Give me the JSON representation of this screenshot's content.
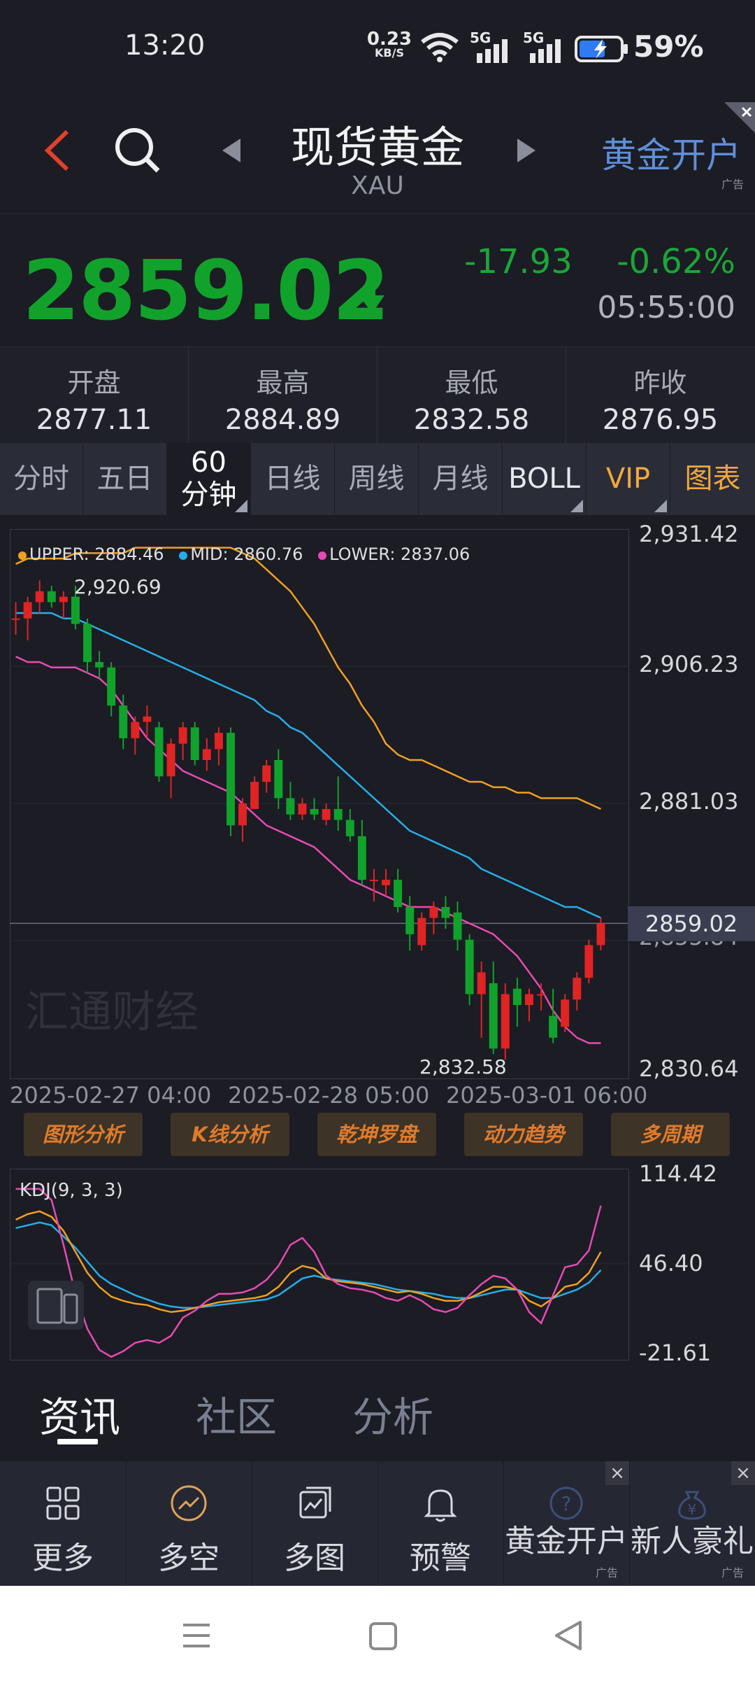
{
  "status": {
    "time": "13:20",
    "net_speed": "0.23",
    "net_unit": "KB/S",
    "sim1": "5G",
    "sim2": "5G",
    "battery": "59%"
  },
  "header": {
    "title": "现货黄金",
    "subtitle": "XAU",
    "promo": "黄金开户",
    "ad_label": "广告",
    "close": "×"
  },
  "price": {
    "last": "2859.02",
    "change": "-17.93",
    "change_pct": "-0.62%",
    "time": "05:55:00",
    "color": "#11a22c"
  },
  "stats": [
    {
      "label": "开盘",
      "value": "2877.11"
    },
    {
      "label": "最高",
      "value": "2884.89"
    },
    {
      "label": "最低",
      "value": "2832.58"
    },
    {
      "label": "昨收",
      "value": "2876.95"
    }
  ],
  "tabs": [
    "分时",
    "五日",
    "60分钟",
    "日线",
    "周线",
    "月线",
    "BOLL",
    "VIP",
    "图表"
  ],
  "legend": {
    "upper": "UPPER: 2884.46",
    "mid": "MID: 2860.76",
    "lower": "LOWER: 2837.06"
  },
  "chart_labels": {
    "y_ticks": [
      "2,931.42",
      "2,906.23",
      "2,881.03",
      "2,855.84",
      "2,830.64"
    ],
    "current_price_tag": "2859.02",
    "high_marker": "2,920.69",
    "low_marker": "2,832.58",
    "x_ticks": [
      "2025-02-27 04:00",
      "2025-02-28 05:00",
      "2025-03-01 06:00"
    ],
    "watermark": "汇通财经"
  },
  "tools": [
    "图形分析",
    "K线分析",
    "乾坤罗盘",
    "动力趋势",
    "多周期"
  ],
  "kdj": {
    "label": "KDJ(9, 3, 3)",
    "y_ticks": [
      "114.42",
      "46.40",
      "-21.61"
    ]
  },
  "news_tabs": [
    "资讯",
    "社区",
    "分析"
  ],
  "bottom_bar": [
    {
      "label": "更多",
      "icon": "grid-icon"
    },
    {
      "label": "多空",
      "icon": "trend-icon"
    },
    {
      "label": "多图",
      "icon": "multi-chart-icon"
    },
    {
      "label": "预警",
      "icon": "bell-icon"
    },
    {
      "label": "黄金开户",
      "icon": "help-icon",
      "ad": "广告"
    },
    {
      "label": "新人豪礼",
      "icon": "money-bag-icon",
      "ad": "广告"
    }
  ],
  "colors": {
    "up": "#e02424",
    "down": "#11a22c",
    "upper": "#f0a020",
    "mid": "#26aee8",
    "lower": "#e84ab4",
    "promo": "#5f8fd8",
    "vip": "#f2a83a"
  },
  "chart_data": {
    "type": "candlestick",
    "ylim": [
      2830.64,
      2931.42
    ],
    "candles": [
      [
        2915,
        2918,
        2912,
        2915
      ],
      [
        2915,
        2919,
        2911,
        2918
      ],
      [
        2918,
        2922,
        2916,
        2920
      ],
      [
        2920,
        2921,
        2917,
        2918
      ],
      [
        2918,
        2920,
        2915,
        2919
      ],
      [
        2919,
        2921,
        2913,
        2914
      ],
      [
        2914,
        2915,
        2905,
        2907
      ],
      [
        2907,
        2909,
        2904,
        2906
      ],
      [
        2906,
        2907,
        2897,
        2899
      ],
      [
        2899,
        2901,
        2891,
        2893
      ],
      [
        2893,
        2897,
        2890,
        2896
      ],
      [
        2896,
        2899,
        2893,
        2897
      ],
      [
        2895,
        2896,
        2885,
        2886
      ],
      [
        2886,
        2893,
        2882,
        2892
      ],
      [
        2892,
        2896,
        2889,
        2895
      ],
      [
        2895,
        2896,
        2888,
        2889
      ],
      [
        2889,
        2893,
        2887,
        2891
      ],
      [
        2891,
        2895,
        2888,
        2894
      ],
      [
        2894,
        2895,
        2875,
        2877
      ],
      [
        2877,
        2882,
        2874,
        2881
      ],
      [
        2880,
        2886,
        2880,
        2885
      ],
      [
        2885,
        2889,
        2883,
        2888
      ],
      [
        2889,
        2891,
        2880,
        2882
      ],
      [
        2882,
        2885,
        2878,
        2879
      ],
      [
        2879,
        2882,
        2878,
        2881
      ],
      [
        2880,
        2882,
        2878,
        2879
      ],
      [
        2878,
        2881,
        2877,
        2880
      ],
      [
        2880,
        2886,
        2876,
        2878
      ],
      [
        2878,
        2880,
        2874,
        2875
      ],
      [
        2875,
        2878,
        2866,
        2867
      ],
      [
        2867,
        2869,
        2863,
        2867
      ],
      [
        2866,
        2869,
        2864,
        2867
      ],
      [
        2867,
        2869,
        2861,
        2862
      ],
      [
        2862,
        2864,
        2854,
        2857
      ],
      [
        2855,
        2861,
        2854,
        2860
      ],
      [
        2860,
        2863,
        2857,
        2862
      ],
      [
        2862,
        2864,
        2858,
        2860
      ],
      [
        2861,
        2863,
        2854,
        2856
      ],
      [
        2856,
        2857,
        2844,
        2846
      ],
      [
        2846,
        2852,
        2838,
        2850
      ],
      [
        2848,
        2852,
        2835,
        2836
      ],
      [
        2836,
        2848,
        2834,
        2846
      ],
      [
        2847,
        2849,
        2840,
        2844
      ],
      [
        2844,
        2847,
        2841,
        2846
      ],
      [
        2846,
        2848,
        2843,
        2846
      ],
      [
        2842,
        2847,
        2837,
        2838
      ],
      [
        2840,
        2846,
        2839,
        2845
      ],
      [
        2845,
        2850,
        2843,
        2849
      ],
      [
        2849,
        2856,
        2848,
        2855
      ],
      [
        2855,
        2860,
        2854,
        2859
      ]
    ],
    "boll_upper": [
      2925,
      2926,
      2926,
      2926,
      2926,
      2927,
      2927,
      2927,
      2927,
      2927,
      2928,
      2928,
      2928,
      2928,
      2928,
      2928,
      2928,
      2928,
      2928,
      2927,
      2926,
      2924,
      2922,
      2920,
      2917,
      2914,
      2910,
      2906,
      2903,
      2899,
      2896,
      2892,
      2890,
      2889,
      2889,
      2888,
      2887,
      2886,
      2885,
      2885,
      2884,
      2884,
      2883,
      2883,
      2882,
      2882,
      2882,
      2882,
      2881,
      2880
    ],
    "boll_mid": [
      2916,
      2916,
      2916,
      2916,
      2915,
      2915,
      2914,
      2913,
      2912,
      2911,
      2910,
      2909,
      2908,
      2907,
      2906,
      2905,
      2904,
      2903,
      2902,
      2901,
      2900,
      2898,
      2897,
      2895,
      2894,
      2892,
      2890,
      2888,
      2886,
      2884,
      2882,
      2880,
      2878,
      2876,
      2875,
      2874,
      2873,
      2872,
      2871,
      2869,
      2868,
      2867,
      2866,
      2865,
      2864,
      2863,
      2862,
      2862,
      2861,
      2860
    ],
    "boll_lower": [
      2908,
      2907,
      2907,
      2906,
      2906,
      2906,
      2905,
      2904,
      2902,
      2899,
      2896,
      2893,
      2891,
      2889,
      2887,
      2886,
      2885,
      2884,
      2883,
      2881,
      2879,
      2877,
      2876,
      2875,
      2874,
      2873,
      2871,
      2869,
      2867,
      2866,
      2865,
      2864,
      2863,
      2862,
      2862,
      2862,
      2861,
      2860,
      2859,
      2858,
      2857,
      2855,
      2853,
      2850,
      2847,
      2843,
      2840,
      2838,
      2837,
      2837
    ],
    "kdj": {
      "ylim": [
        -21.61,
        114.42
      ],
      "k": [
        78,
        82,
        84,
        80,
        70,
        55,
        40,
        30,
        23,
        20,
        18,
        17,
        14,
        12,
        13,
        15,
        17,
        19,
        20,
        21,
        22,
        24,
        30,
        40,
        45,
        43,
        36,
        34,
        33,
        32,
        30,
        28,
        26,
        27,
        25,
        22,
        20,
        20,
        22,
        26,
        30,
        30,
        28,
        20,
        16,
        22,
        30,
        32,
        40,
        55
      ],
      "d": [
        72,
        74,
        76,
        74,
        66,
        58,
        48,
        38,
        32,
        28,
        24,
        21,
        18,
        16,
        15,
        15,
        16,
        17,
        18,
        19,
        20,
        21,
        24,
        30,
        36,
        38,
        36,
        35,
        34,
        33,
        32,
        30,
        28,
        27,
        26,
        25,
        23,
        22,
        22,
        24,
        26,
        28,
        28,
        25,
        22,
        22,
        25,
        28,
        33,
        42
      ],
      "j": [
        100,
        100,
        100,
        92,
        60,
        25,
        0,
        -15,
        -20,
        -16,
        -10,
        -8,
        -10,
        -5,
        8,
        13,
        20,
        25,
        25,
        26,
        29,
        35,
        45,
        60,
        65,
        55,
        38,
        32,
        29,
        28,
        26,
        22,
        20,
        24,
        20,
        14,
        12,
        15,
        24,
        32,
        38,
        36,
        28,
        12,
        4,
        24,
        44,
        46,
        56,
        88
      ]
    }
  }
}
